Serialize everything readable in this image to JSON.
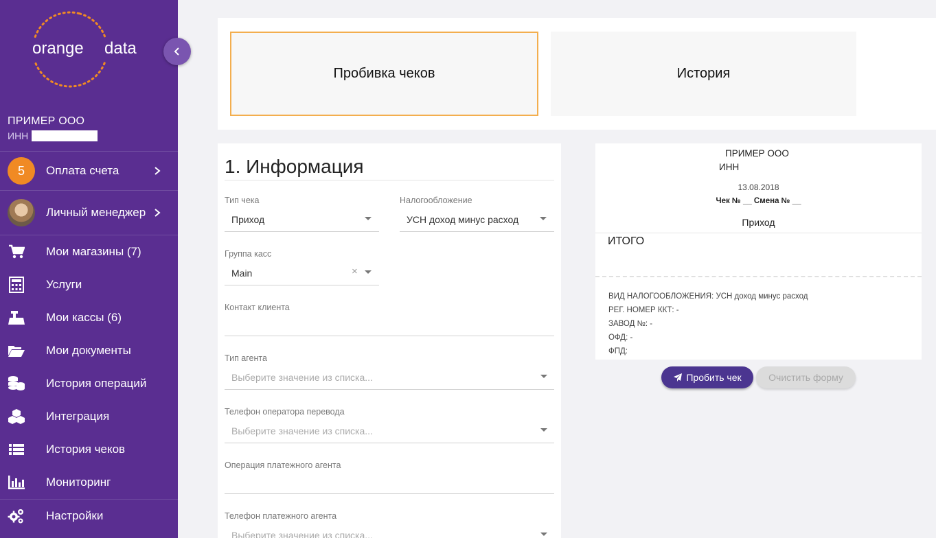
{
  "sidebar": {
    "logo": {
      "left": "orange",
      "right": "data"
    },
    "org_name": "ПРИМЕР ООО",
    "inn_label": "ИНН",
    "items": [
      {
        "label": "Оплата счета",
        "badge": "5",
        "icon": "badge"
      },
      {
        "label": "Личный менеджер",
        "icon": "avatar"
      },
      {
        "label": "Мои магазины (7)",
        "icon": "cart-icon"
      },
      {
        "label": "Услуги",
        "icon": "calculator-icon"
      },
      {
        "label": "Мои кассы (6)",
        "icon": "cash-register-icon"
      },
      {
        "label": "Мои документы",
        "icon": "folder-icon"
      },
      {
        "label": "История операций",
        "icon": "coins-icon"
      },
      {
        "label": "Интеграция",
        "icon": "cubes-icon"
      },
      {
        "label": "История чеков",
        "icon": "list-icon"
      },
      {
        "label": "Мониторинг",
        "icon": "bar-chart-icon"
      },
      {
        "label": "Настройки",
        "icon": "gears-icon"
      }
    ]
  },
  "tabs": [
    {
      "label": "Пробивка чеков",
      "active": true
    },
    {
      "label": "История",
      "active": false
    }
  ],
  "form": {
    "title": "1. Информация",
    "fields": {
      "receipt_type": {
        "label": "Тип чека",
        "value": "Приход"
      },
      "taxation": {
        "label": "Налогообложение",
        "value": "УСН доход минус расход"
      },
      "cash_group": {
        "label": "Группа касс",
        "value": "Main"
      },
      "client_contact": {
        "label": "Контакт клиента",
        "value": ""
      },
      "agent_type": {
        "label": "Тип агента",
        "placeholder": "Выберите значение из списка..."
      },
      "transfer_operator_phone": {
        "label": "Телефон оператора перевода",
        "placeholder": "Выберите значение из списка..."
      },
      "payment_agent_operation": {
        "label": "Операция платежного агента",
        "value": ""
      },
      "payment_agent_phone": {
        "label": "Телефон платежного агента",
        "placeholder": "Выберите значение из списка..."
      }
    }
  },
  "receipt": {
    "org_name": "ПРИМЕР ООО",
    "inn_label": "ИНН",
    "date": "13.08.2018",
    "check_shift": "Чек № __ Смена № __",
    "type": "Приход",
    "total_label": "ИТОГО",
    "tax_line": "ВИД НАЛОГООБЛОЖЕНИЯ: УСН доход минус расход",
    "reg_line": "РЕГ. НОМЕР ККТ: -",
    "factory_line": "ЗАВОД №: -",
    "ofd_line": "ОФД: -",
    "fpd_line": "ФПД:"
  },
  "actions": {
    "submit": "Пробить чек",
    "clear": "Очистить форму"
  },
  "colors": {
    "sidebar": "#5a2e91",
    "accent_orange": "#f08a24",
    "active_tab_border": "#f3ae4e",
    "primary_button": "#4b3590"
  }
}
